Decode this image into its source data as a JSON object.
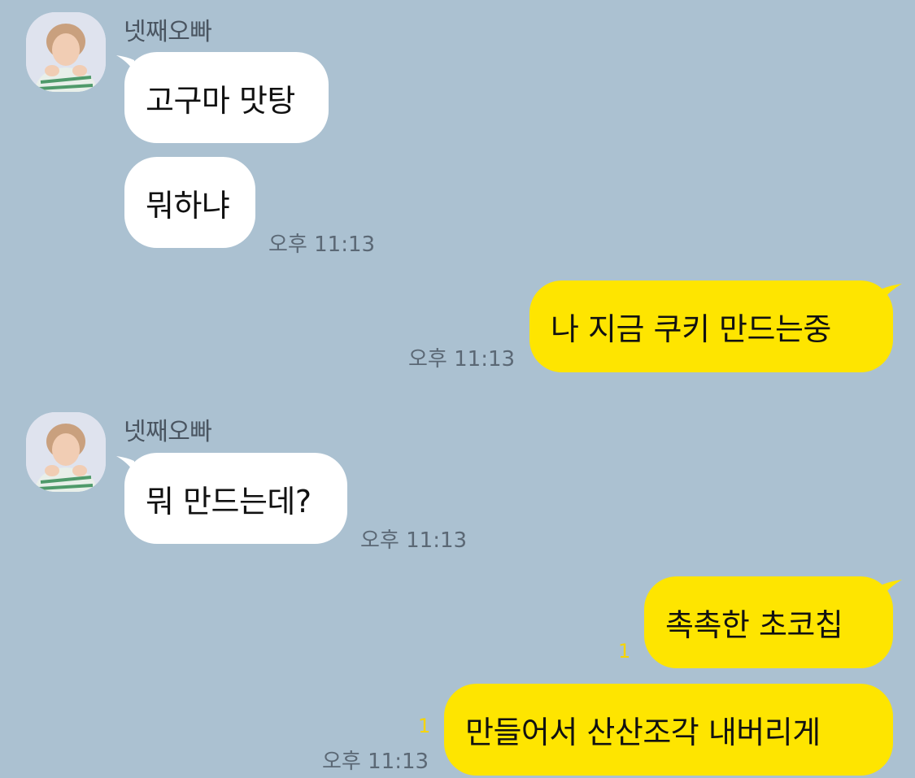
{
  "chat": {
    "colors": {
      "background": "#abc1d1",
      "incoming_bubble": "#ffffff",
      "outgoing_bubble": "#fee500",
      "unread": "#f6d400"
    },
    "group1": {
      "sender": "넷째오빠",
      "avatar_icon": "profile-photo"
    },
    "group2": {
      "sender": "넷째오빠",
      "avatar_icon": "profile-photo"
    },
    "messages": [
      {
        "text": "고구마 맛탕",
        "side": "incoming"
      },
      {
        "text": "뭐하냐",
        "side": "incoming",
        "time": "오후 11:13"
      },
      {
        "text": "나 지금 쿠키 만드는중",
        "side": "outgoing",
        "time": "오후 11:13"
      },
      {
        "text": "뭐 만드는데?",
        "side": "incoming",
        "time": "오후 11:13"
      },
      {
        "text": "촉촉한 초코칩",
        "side": "outgoing",
        "unread": "1"
      },
      {
        "text": "만들어서 산산조각 내버리게",
        "side": "outgoing",
        "unread": "1",
        "time": "오후 11:13"
      }
    ]
  }
}
